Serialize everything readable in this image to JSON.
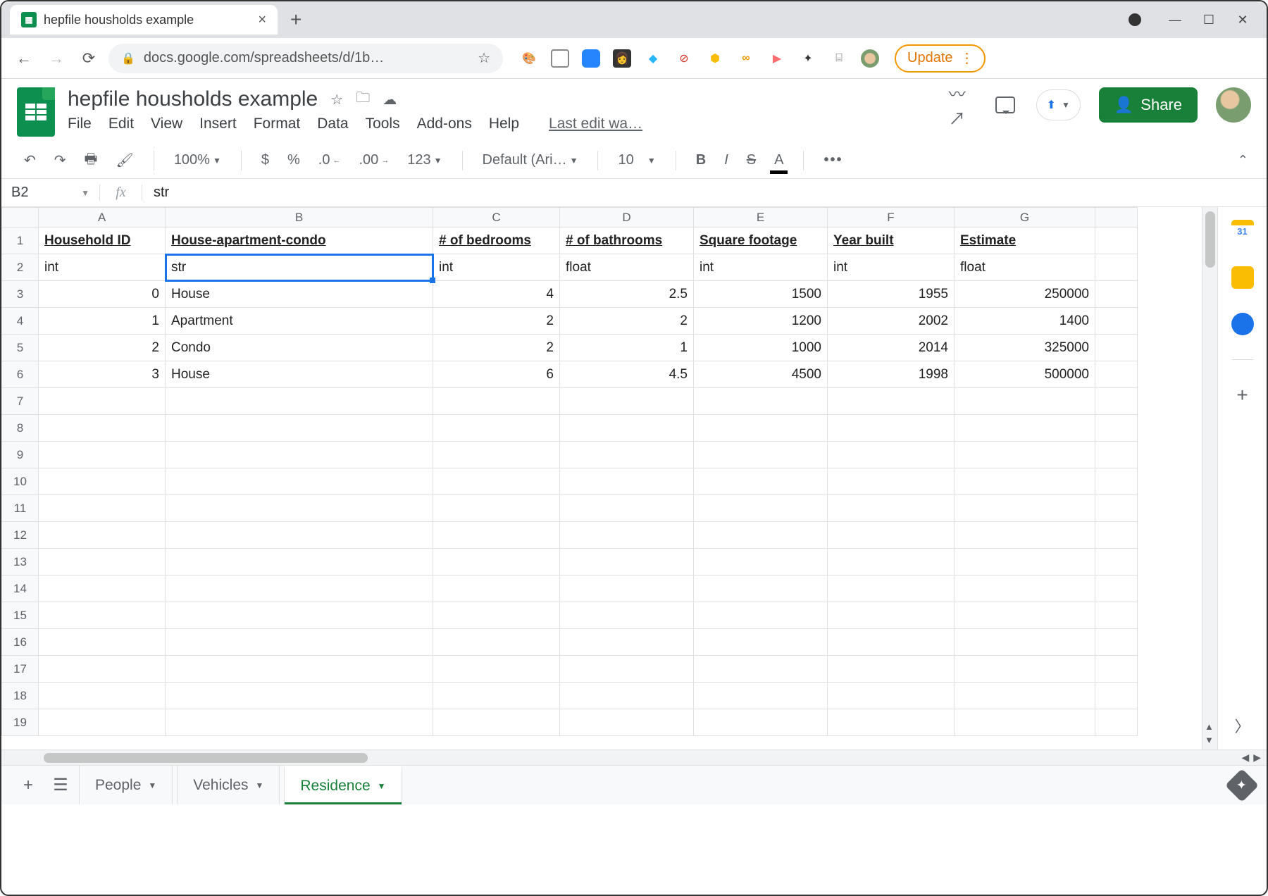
{
  "browser": {
    "tab_title": "hepfile housholds example",
    "url_display": "docs.google.com/spreadsheets/d/1b…",
    "update_label": "Update"
  },
  "doc": {
    "title": "hepfile housholds example",
    "menus": [
      "File",
      "Edit",
      "View",
      "Insert",
      "Format",
      "Data",
      "Tools",
      "Add-ons",
      "Help"
    ],
    "last_edit": "Last edit wa…",
    "share_label": "Share"
  },
  "toolbar": {
    "zoom": "100%",
    "currency": "$",
    "percent": "%",
    "dec_dec": ".0",
    "inc_dec": ".00",
    "numfmt": "123",
    "font": "Default (Ari…",
    "font_size": "10"
  },
  "formula": {
    "name_box": "B2",
    "value": "str"
  },
  "columns": [
    "A",
    "B",
    "C",
    "D",
    "E",
    "F",
    "G",
    ""
  ],
  "headers": [
    "Household ID",
    "House-apartment-condo",
    "# of bedrooms",
    "# of bathrooms",
    "Square footage",
    "Year built",
    "Estimate"
  ],
  "types": [
    "int",
    "str",
    "int",
    "float",
    "int",
    "int",
    "float"
  ],
  "rows": [
    {
      "id": "0",
      "type": "House",
      "beds": "4",
      "baths": "2.5",
      "sqft": "1500",
      "year": "1955",
      "est": "250000"
    },
    {
      "id": "1",
      "type": "Apartment",
      "beds": "2",
      "baths": "2",
      "sqft": "1200",
      "year": "2002",
      "est": "1400"
    },
    {
      "id": "2",
      "type": "Condo",
      "beds": "2",
      "baths": "1",
      "sqft": "1000",
      "year": "2014",
      "est": "325000"
    },
    {
      "id": "3",
      "type": "House",
      "beds": "6",
      "baths": "4.5",
      "sqft": "4500",
      "year": "1998",
      "est": "500000"
    }
  ],
  "sheet_tabs": {
    "inactive": [
      "People",
      "Vehicles"
    ],
    "active": "Residence"
  },
  "chart_data": {
    "type": "table",
    "title": "hepfile housholds example — Residence sheet",
    "columns": [
      "Household ID",
      "House-apartment-condo",
      "# of bedrooms",
      "# of bathrooms",
      "Square footage",
      "Year built",
      "Estimate"
    ],
    "dtypes": [
      "int",
      "str",
      "int",
      "float",
      "int",
      "int",
      "float"
    ],
    "records": [
      [
        0,
        "House",
        4,
        2.5,
        1500,
        1955,
        250000
      ],
      [
        1,
        "Apartment",
        2,
        2,
        1200,
        2002,
        1400
      ],
      [
        2,
        "Condo",
        2,
        1,
        1000,
        2014,
        325000
      ],
      [
        3,
        "House",
        6,
        4.5,
        4500,
        1998,
        500000
      ]
    ]
  }
}
